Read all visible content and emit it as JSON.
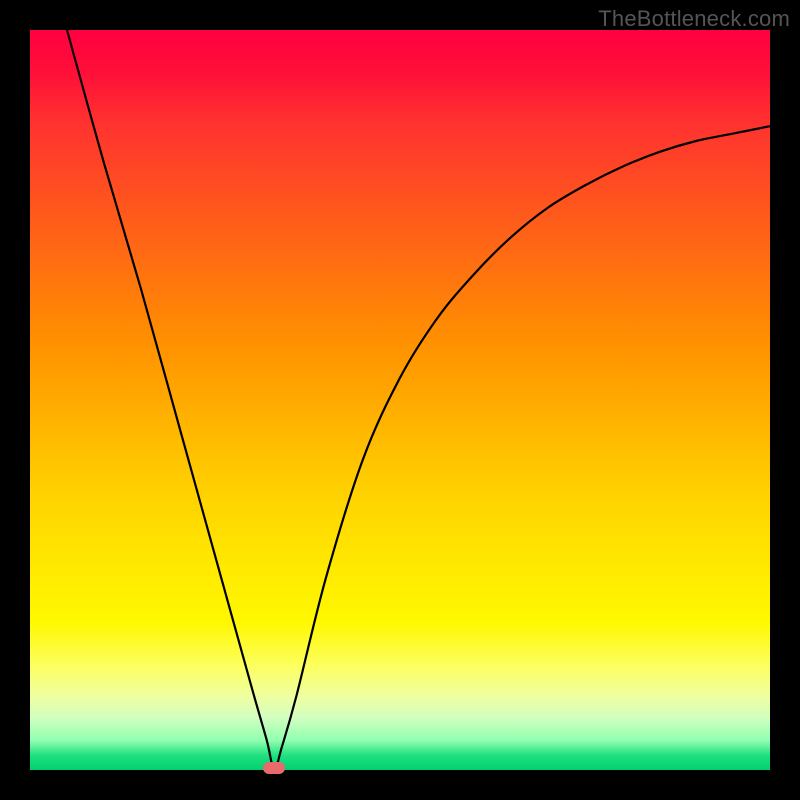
{
  "watermark": "TheBottleneck.com",
  "colors": {
    "frame": "#000000",
    "curve": "#000000",
    "marker": "#e96a6a"
  },
  "chart_data": {
    "type": "line",
    "title": "",
    "xlabel": "",
    "ylabel": "",
    "xlim": [
      0,
      100
    ],
    "ylim": [
      0,
      100
    ],
    "grid": false,
    "legend": false,
    "series": [
      {
        "name": "bottleneck-curve",
        "x": [
          5,
          10,
          15,
          20,
          25,
          30,
          32,
          33,
          34,
          36,
          40,
          45,
          50,
          55,
          60,
          65,
          70,
          75,
          80,
          85,
          90,
          95,
          100
        ],
        "values": [
          100,
          82,
          65,
          47,
          29,
          11,
          4,
          0,
          3,
          10,
          26,
          42,
          53,
          61,
          67,
          72,
          76,
          79,
          81.5,
          83.5,
          85,
          86,
          87
        ]
      }
    ],
    "markers": [
      {
        "name": "optimal-point",
        "x": 33,
        "y": 0
      }
    ]
  }
}
